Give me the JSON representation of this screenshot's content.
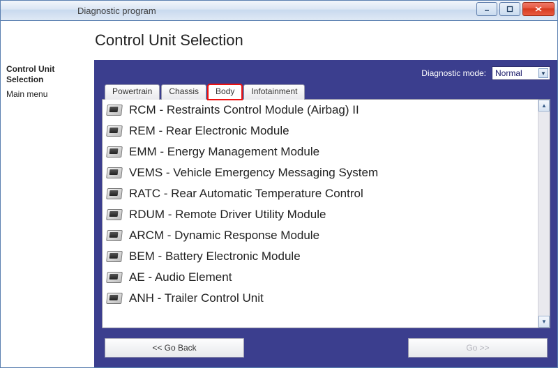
{
  "window": {
    "title": "Diagnostic program"
  },
  "header": {
    "title": "Control Unit Selection"
  },
  "sidebar": {
    "current": "Control Unit Selection",
    "mainmenu": "Main menu"
  },
  "mode": {
    "label": "Diagnostic mode:",
    "value": "Normal"
  },
  "tabs": [
    {
      "label": "Powertrain",
      "active": false
    },
    {
      "label": "Chassis",
      "active": false
    },
    {
      "label": "Body",
      "active": true
    },
    {
      "label": "Infotainment",
      "active": false
    }
  ],
  "modules": [
    "RCM - Restraints Control Module (Airbag) II",
    "REM - Rear Electronic Module",
    "EMM - Energy Management Module",
    "VEMS - Vehicle Emergency Messaging System",
    "RATC - Rear Automatic Temperature Control",
    "RDUM - Remote Driver Utility Module",
    "ARCM - Dynamic Response Module",
    "BEM - Battery Electronic Module",
    "AE - Audio Element",
    "ANH - Trailer Control Unit"
  ],
  "footer": {
    "back": "<< Go Back",
    "go": "Go >>"
  }
}
